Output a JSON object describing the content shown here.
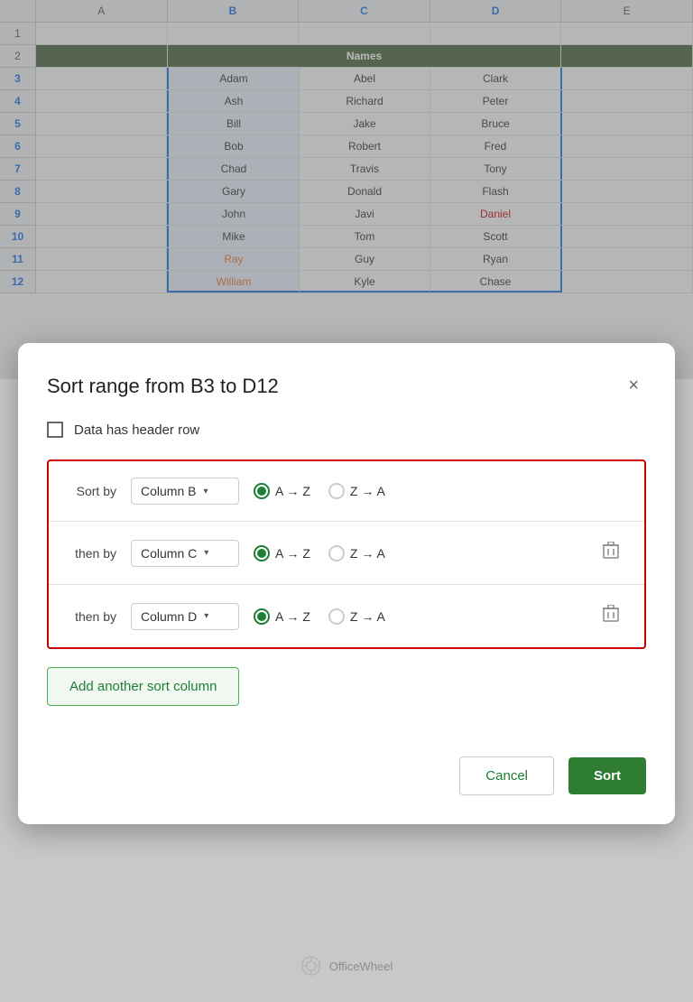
{
  "spreadsheet": {
    "col_headers": [
      "A",
      "B",
      "C",
      "D",
      "E"
    ],
    "row_numbers": [
      "1",
      "2",
      "3",
      "4",
      "5",
      "6",
      "7",
      "8",
      "9",
      "10",
      "11",
      "12"
    ],
    "active_rows": [
      "3",
      "4",
      "5",
      "6",
      "7",
      "8",
      "9",
      "10",
      "11",
      "12"
    ],
    "names_header": "Names",
    "table_data": [
      {
        "b": "Adam",
        "c": "Abel",
        "d": "Clark",
        "b_style": "",
        "c_style": "",
        "d_style": ""
      },
      {
        "b": "Ash",
        "c": "Richard",
        "d": "Peter",
        "b_style": "",
        "c_style": "",
        "d_style": ""
      },
      {
        "b": "Bill",
        "c": "Jake",
        "d": "Bruce",
        "b_style": "",
        "c_style": "",
        "d_style": ""
      },
      {
        "b": "Bob",
        "c": "Robert",
        "d": "Fred",
        "b_style": "",
        "c_style": "",
        "d_style": ""
      },
      {
        "b": "Chad",
        "c": "Travis",
        "d": "Tony",
        "b_style": "",
        "c_style": "",
        "d_style": ""
      },
      {
        "b": "Gary",
        "c": "Donald",
        "d": "Flash",
        "b_style": "",
        "c_style": "",
        "d_style": ""
      },
      {
        "b": "John",
        "c": "Javi",
        "d": "Daniel",
        "b_style": "",
        "c_style": "",
        "d_style": "red"
      },
      {
        "b": "Mike",
        "c": "Tom",
        "d": "Scott",
        "b_style": "",
        "c_style": "",
        "d_style": ""
      },
      {
        "b": "Ray",
        "c": "Guy",
        "d": "Ryan",
        "b_style": "orange",
        "c_style": "",
        "d_style": ""
      },
      {
        "b": "William",
        "c": "Kyle",
        "d": "Chase",
        "b_style": "orange",
        "c_style": "",
        "d_style": ""
      }
    ]
  },
  "dialog": {
    "title": "Sort range from B3 to D12",
    "close_label": "×",
    "header_row_label": "Data has header row",
    "sort_rules": [
      {
        "label": "Sort by",
        "column": "Column B",
        "az_label": "A → Z",
        "za_label": "Z → A",
        "az_selected": true,
        "has_delete": false
      },
      {
        "label": "then by",
        "column": "Column C",
        "az_label": "A → Z",
        "za_label": "Z → A",
        "az_selected": true,
        "has_delete": true
      },
      {
        "label": "then by",
        "column": "Column D",
        "az_label": "A → Z",
        "za_label": "Z → A",
        "az_selected": true,
        "has_delete": true
      }
    ],
    "add_sort_label": "Add another sort column",
    "cancel_label": "Cancel",
    "sort_label": "Sort"
  },
  "watermark": {
    "text": "OfficeWheel"
  }
}
